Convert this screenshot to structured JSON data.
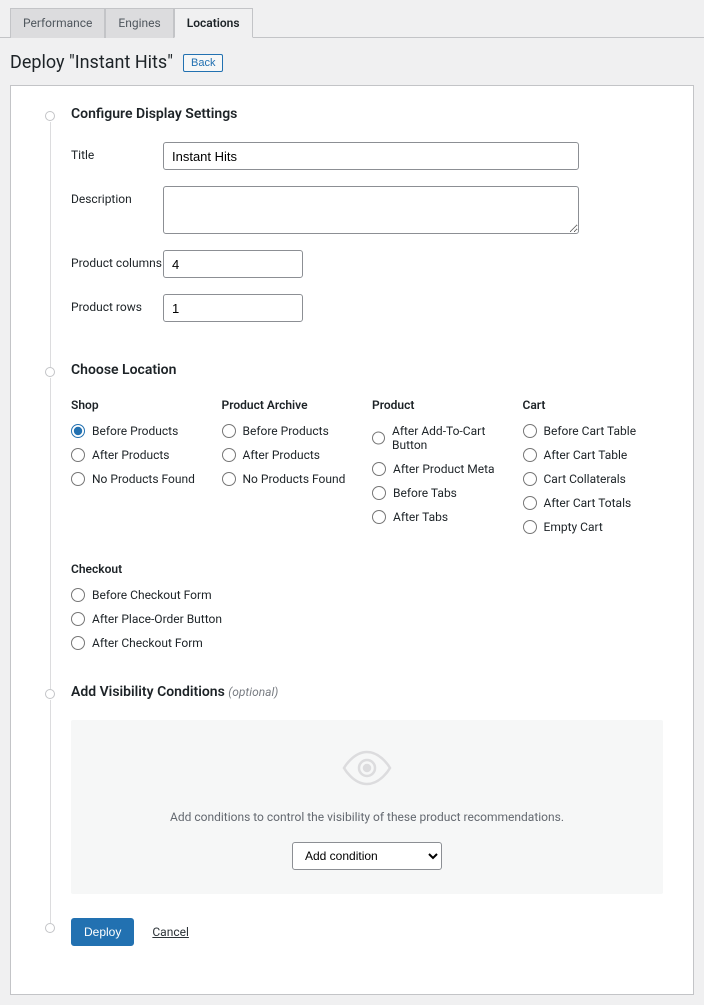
{
  "tabs": {
    "performance": "Performance",
    "engines": "Engines",
    "locations": "Locations"
  },
  "header": {
    "title": "Deploy \"Instant Hits\"",
    "back": "Back"
  },
  "section_configure": {
    "heading": "Configure Display Settings",
    "labels": {
      "title": "Title",
      "description": "Description",
      "product_columns": "Product columns",
      "product_rows": "Product rows"
    },
    "values": {
      "title": "Instant Hits",
      "description": "",
      "product_columns": "4",
      "product_rows": "1"
    }
  },
  "section_location": {
    "heading": "Choose Location",
    "groups": {
      "shop": {
        "label": "Shop",
        "options": [
          "Before Products",
          "After Products",
          "No Products Found"
        ]
      },
      "product_archive": {
        "label": "Product Archive",
        "options": [
          "Before Products",
          "After Products",
          "No Products Found"
        ]
      },
      "product": {
        "label": "Product",
        "options": [
          "After Add-To-Cart Button",
          "After Product Meta",
          "Before Tabs",
          "After Tabs"
        ]
      },
      "cart": {
        "label": "Cart",
        "options": [
          "Before Cart Table",
          "After Cart Table",
          "Cart Collaterals",
          "After Cart Totals",
          "Empty Cart"
        ]
      },
      "checkout": {
        "label": "Checkout",
        "options": [
          "Before Checkout Form",
          "After Place-Order Button",
          "After Checkout Form"
        ]
      }
    },
    "selected": "Before Products"
  },
  "section_visibility": {
    "heading": "Add Visibility Conditions",
    "optional": "(optional)",
    "hint": "Add conditions to control the visibility of these product recommendations.",
    "add_condition": "Add condition"
  },
  "actions": {
    "deploy": "Deploy",
    "cancel": "Cancel"
  }
}
